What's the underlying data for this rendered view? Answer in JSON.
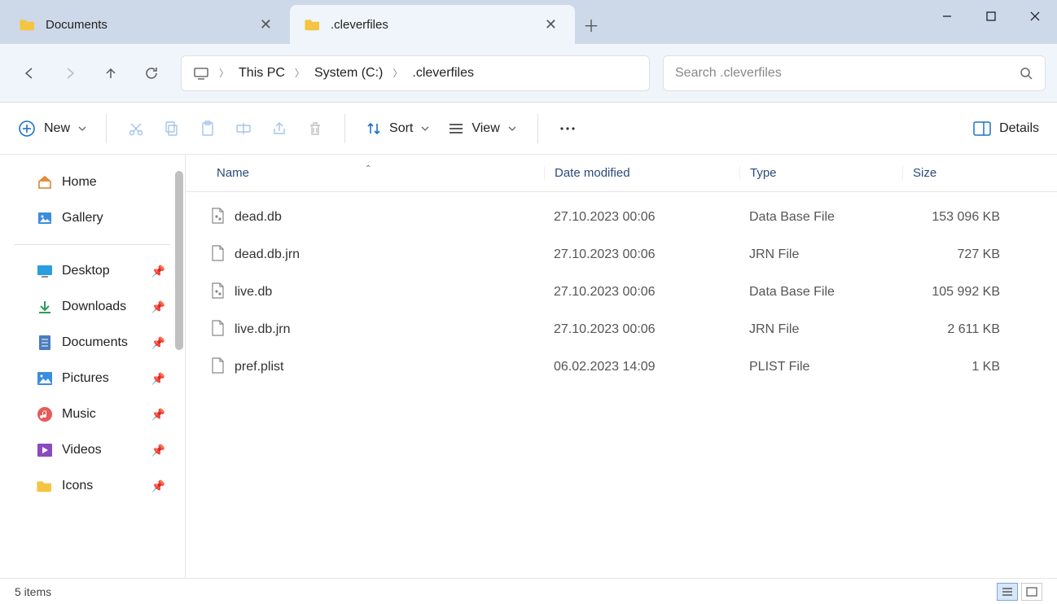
{
  "tabs": [
    {
      "label": "Documents",
      "active": false
    },
    {
      "label": ".cleverfiles",
      "active": true
    }
  ],
  "nav": {
    "back_enabled": true,
    "forward_enabled": false
  },
  "breadcrumb": [
    {
      "label": "This PC"
    },
    {
      "label": "System (C:)"
    },
    {
      "label": ".cleverfiles"
    }
  ],
  "search": {
    "placeholder": "Search .cleverfiles"
  },
  "toolbar": {
    "new_label": "New",
    "sort_label": "Sort",
    "view_label": "View",
    "details_label": "Details"
  },
  "sidebar": {
    "top": [
      {
        "label": "Home",
        "icon": "home"
      },
      {
        "label": "Gallery",
        "icon": "gallery"
      }
    ],
    "pinned": [
      {
        "label": "Desktop",
        "icon": "desktop"
      },
      {
        "label": "Downloads",
        "icon": "downloads"
      },
      {
        "label": "Documents",
        "icon": "documents"
      },
      {
        "label": "Pictures",
        "icon": "pictures"
      },
      {
        "label": "Music",
        "icon": "music"
      },
      {
        "label": "Videos",
        "icon": "videos"
      },
      {
        "label": "Icons",
        "icon": "folder"
      }
    ]
  },
  "columns": {
    "name": "Name",
    "date": "Date modified",
    "type": "Type",
    "size": "Size"
  },
  "files": [
    {
      "name": "dead.db",
      "date": "27.10.2023 00:06",
      "type": "Data Base File",
      "size": "153 096 KB",
      "icon": "db"
    },
    {
      "name": "dead.db.jrn",
      "date": "27.10.2023 00:06",
      "type": "JRN File",
      "size": "727 KB",
      "icon": "file"
    },
    {
      "name": "live.db",
      "date": "27.10.2023 00:06",
      "type": "Data Base File",
      "size": "105 992 KB",
      "icon": "db"
    },
    {
      "name": "live.db.jrn",
      "date": "27.10.2023 00:06",
      "type": "JRN File",
      "size": "2 611 KB",
      "icon": "file"
    },
    {
      "name": "pref.plist",
      "date": "06.02.2023 14:09",
      "type": "PLIST File",
      "size": "1 KB",
      "icon": "file"
    }
  ],
  "status": {
    "text": "5 items"
  }
}
